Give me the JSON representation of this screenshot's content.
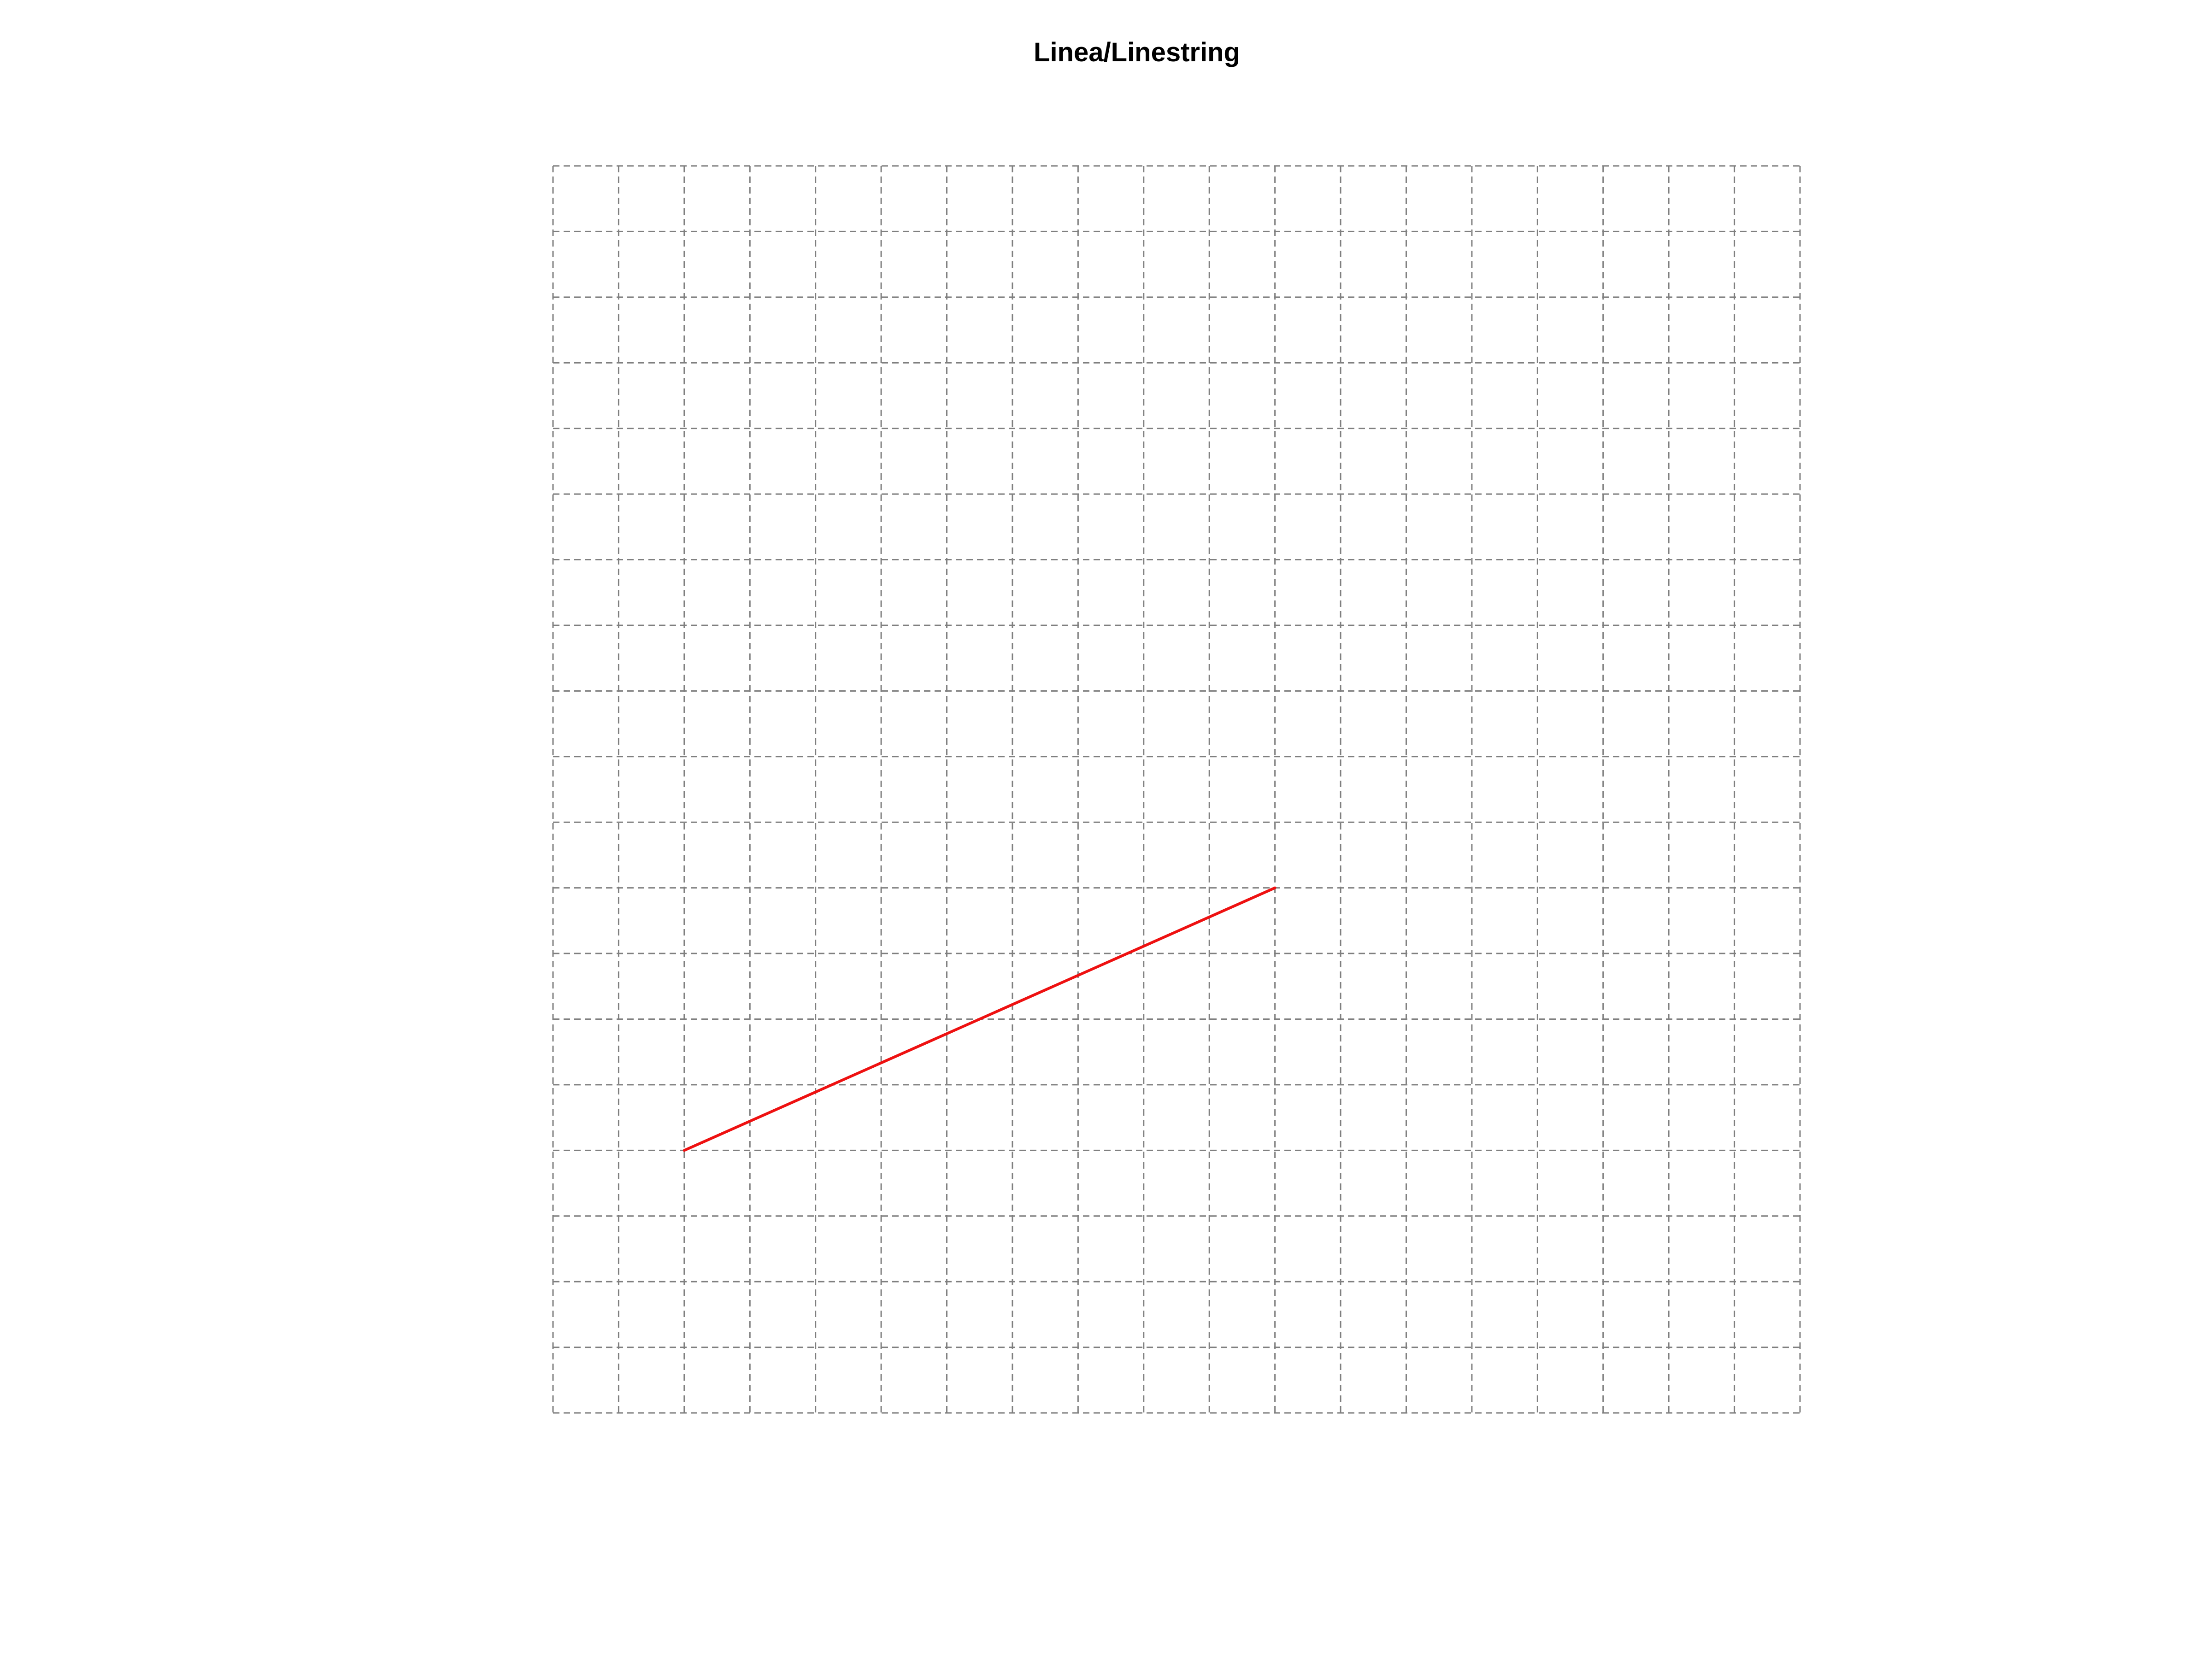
{
  "chart_data": {
    "type": "line",
    "title": "Linea/Linestring",
    "xlabel": "",
    "ylabel": "",
    "xlim": [
      0,
      19
    ],
    "ylim": [
      0,
      19
    ],
    "grid": true,
    "grid_style": "dashed",
    "grid_color": "#7f7f7f",
    "series": [
      {
        "color": "#ee1111",
        "x": [
          2,
          11
        ],
        "y": [
          4,
          8
        ]
      }
    ]
  }
}
